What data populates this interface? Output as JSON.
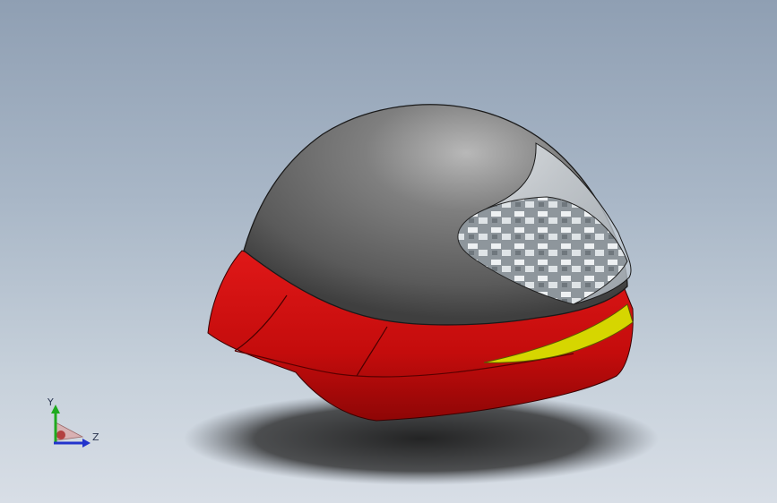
{
  "viewport": {
    "background_top": "#8f9fb3",
    "background_bottom": "#d8dee6"
  },
  "model": {
    "shell_color": "#6b6b6b",
    "trim_color": "#d01010",
    "stripe_color": "#d8d800",
    "visor_color": "#cfd6dc"
  },
  "triad": {
    "y_label": "Y",
    "z_label": "Z",
    "y_color": "#1faa1f",
    "z_color": "#2233cc"
  }
}
